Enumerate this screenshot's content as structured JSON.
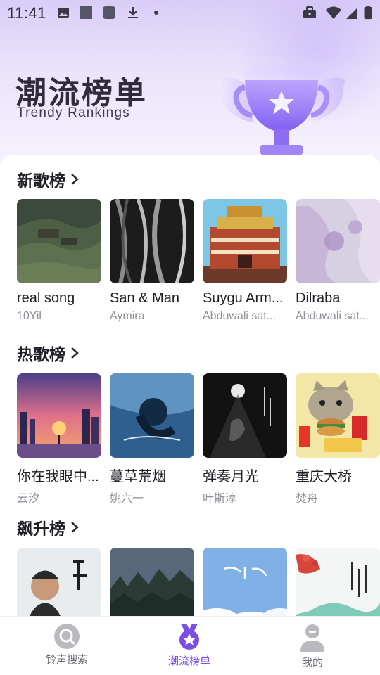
{
  "status_bar": {
    "time": "11:41"
  },
  "hero": {
    "title": "潮流榜单",
    "subtitle": "Trendy Rankings"
  },
  "sections": [
    {
      "title": "新歌榜",
      "songs": [
        {
          "name": "real song",
          "artist": "10Yil"
        },
        {
          "name": "San & Man",
          "artist": "Aymira"
        },
        {
          "name": "Suygu Arm...",
          "artist": "Abduwali sat..."
        },
        {
          "name": "Dilraba",
          "artist": "Abduwali sat..."
        }
      ]
    },
    {
      "title": "热歌榜",
      "songs": [
        {
          "name": "你在我眼中...",
          "artist": "云汐"
        },
        {
          "name": "蔓草荒烟",
          "artist": "姚六一"
        },
        {
          "name": "弹奏月光",
          "artist": "叶斯淳"
        },
        {
          "name": "重庆大桥",
          "artist": "焚舟"
        }
      ]
    },
    {
      "title": "飙升榜",
      "songs": [
        {
          "name": "",
          "artist": ""
        },
        {
          "name": "",
          "artist": ""
        },
        {
          "name": "",
          "artist": ""
        },
        {
          "name": "",
          "artist": ""
        }
      ]
    }
  ],
  "nav": {
    "items": [
      {
        "label": "铃声搜索",
        "icon": "search-icon"
      },
      {
        "label": "潮流榜单",
        "icon": "medal-star-icon",
        "active": true
      },
      {
        "label": "我的",
        "icon": "profile-icon"
      }
    ]
  },
  "colors": {
    "accent": "#7b4ee4",
    "hero_bg": "#e6dcfa",
    "text": "#1e1e24",
    "muted": "#8f8f98"
  }
}
